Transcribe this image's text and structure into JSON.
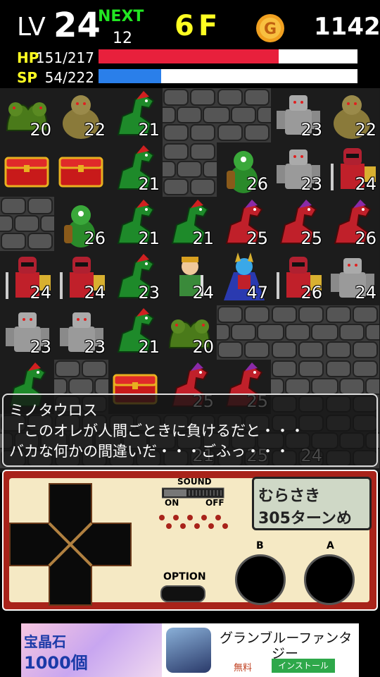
{
  "hud": {
    "level_label": "LV",
    "level_value": "24",
    "next_label": "NEXT",
    "next_value": "12",
    "floor": "6F",
    "gold": "1142",
    "hp_label": "HP",
    "hp_value": "151/217",
    "hp_fraction": 0.696,
    "sp_label": "SP",
    "sp_value": "54/222",
    "sp_fraction": 0.243,
    "hp_color": "#e8203c",
    "sp_color": "#2a7fea"
  },
  "board": {
    "rows": [
      [
        {
          "t": "hydra",
          "l": "20"
        },
        {
          "t": "ogre",
          "l": "22"
        },
        {
          "t": "dragon",
          "l": "21"
        },
        {
          "t": "rock",
          "l": ""
        },
        {
          "t": "rock",
          "l": ""
        },
        {
          "t": "golem",
          "l": "23"
        },
        {
          "t": "ogre",
          "l": "22"
        }
      ],
      [
        {
          "t": "chest",
          "l": ""
        },
        {
          "t": "chest",
          "l": ""
        },
        {
          "t": "dragon",
          "l": "21"
        },
        {
          "t": "rock",
          "l": ""
        },
        {
          "t": "goblin",
          "l": "26"
        },
        {
          "t": "golem",
          "l": "23"
        },
        {
          "t": "knight",
          "l": "24"
        }
      ],
      [
        {
          "t": "rock",
          "l": ""
        },
        {
          "t": "goblin",
          "l": "26"
        },
        {
          "t": "dragon",
          "l": "21"
        },
        {
          "t": "dragon",
          "l": "21"
        },
        {
          "t": "reddragon",
          "l": "25"
        },
        {
          "t": "reddragon",
          "l": "25"
        },
        {
          "t": "reddragon",
          "l": "26"
        }
      ],
      [
        {
          "t": "knight",
          "l": "24"
        },
        {
          "t": "knight",
          "l": "24"
        },
        {
          "t": "dragon",
          "l": "23"
        },
        {
          "t": "hero",
          "l": "24"
        },
        {
          "t": "demon",
          "l": "47"
        },
        {
          "t": "knight",
          "l": "26"
        },
        {
          "t": "golem",
          "l": "24"
        }
      ],
      [
        {
          "t": "golem",
          "l": "23"
        },
        {
          "t": "golem",
          "l": "23"
        },
        {
          "t": "dragon",
          "l": "21"
        },
        {
          "t": "hydra",
          "l": "20"
        },
        {
          "t": "rock",
          "l": ""
        },
        {
          "t": "rock",
          "l": ""
        },
        {
          "t": "rock",
          "l": ""
        }
      ],
      [
        {
          "t": "dragon",
          "l": ""
        },
        {
          "t": "rock",
          "l": ""
        },
        {
          "t": "chest",
          "l": ""
        },
        {
          "t": "reddragon",
          "l": "25"
        },
        {
          "t": "reddragon",
          "l": "25"
        },
        {
          "t": "rock",
          "l": ""
        },
        {
          "t": "rock",
          "l": ""
        }
      ],
      [
        {
          "t": "rock",
          "l": ""
        },
        {
          "t": "rock",
          "l": ""
        },
        {
          "t": "rock",
          "l": ""
        },
        {
          "t": "rock",
          "l": "21"
        },
        {
          "t": "rock",
          "l": "25"
        },
        {
          "t": "rock",
          "l": "24"
        },
        {
          "t": "rock",
          "l": ""
        }
      ]
    ]
  },
  "dialog": {
    "line1": "ミノタウロス",
    "line2": "「このオレが人間ごときに負けるだと・・・",
    "line3": "バカな何かの間違いだ・・・ごふっ・・・"
  },
  "controller": {
    "sound_label": "SOUND",
    "on_label": "ON",
    "off_label": "OFF",
    "option_label": "OPTION",
    "b_label": "B",
    "a_label": "A",
    "screen_line1": "むらさき",
    "screen_line2": "305ターンめ"
  },
  "ad": {
    "left_line1": "宝晶石",
    "left_line2": "1000個",
    "title_line1": "グランブルーファンタ",
    "title_line2": "ジー",
    "free_label": "無料",
    "install_label": "インストール"
  }
}
